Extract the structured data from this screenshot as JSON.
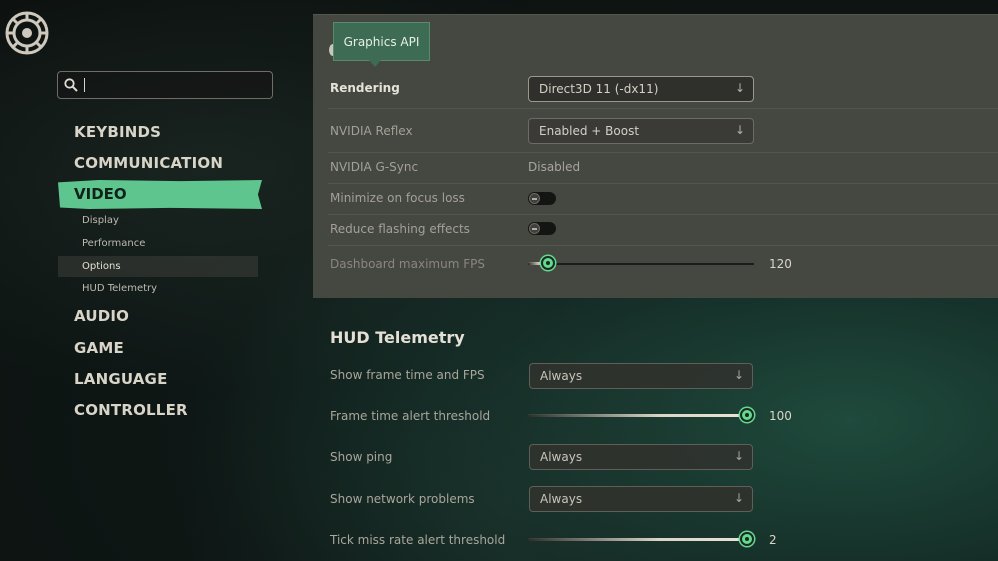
{
  "sidebar": {
    "search": {
      "value": "",
      "placeholder": ""
    },
    "items": [
      {
        "label": "KEYBINDS"
      },
      {
        "label": "COMMUNICATION"
      },
      {
        "label": "VIDEO",
        "active": true
      },
      {
        "label": "AUDIO"
      },
      {
        "label": "GAME"
      },
      {
        "label": "LANGUAGE"
      },
      {
        "label": "CONTROLLER"
      }
    ],
    "video_subitems": [
      {
        "label": "Display"
      },
      {
        "label": "Performance"
      },
      {
        "label": "Options",
        "selected": true
      },
      {
        "label": "HUD Telemetry"
      }
    ]
  },
  "tooltip": {
    "text": "Graphics API"
  },
  "options": {
    "rendering": {
      "label": "Rendering",
      "value": "Direct3D 11 (-dx11)"
    },
    "nvidia_reflex": {
      "label": "NVIDIA Reflex",
      "value": "Enabled + Boost"
    },
    "nvidia_gsync": {
      "label": "NVIDIA G-Sync",
      "value": "Disabled"
    },
    "minimize_focus": {
      "label": "Minimize on focus loss",
      "enabled": false
    },
    "reduce_flashing": {
      "label": "Reduce flashing effects",
      "enabled": false
    },
    "dashboard_fps": {
      "label": "Dashboard maximum FPS",
      "value": "120",
      "fraction": 0.09
    }
  },
  "hud": {
    "title": "HUD Telemetry",
    "frame_time_fps": {
      "label": "Show frame time and FPS",
      "value": "Always"
    },
    "frame_alert": {
      "label": "Frame time alert threshold",
      "value": "100",
      "fraction": 1.0
    },
    "ping": {
      "label": "Show ping",
      "value": "Always"
    },
    "network": {
      "label": "Show network problems",
      "value": "Always"
    },
    "tick_miss": {
      "label": "Tick miss rate alert threshold",
      "value": "2",
      "fraction": 1.0
    }
  },
  "colors": {
    "accent": "#5fc58e",
    "slider_knob": "#64d98f",
    "panel": "#454741"
  },
  "icons": {
    "logo": "wheel-emblem-icon",
    "search": "search-icon",
    "dropdown": "arrow-down-icon",
    "toggle": "toggle-off-icon"
  }
}
